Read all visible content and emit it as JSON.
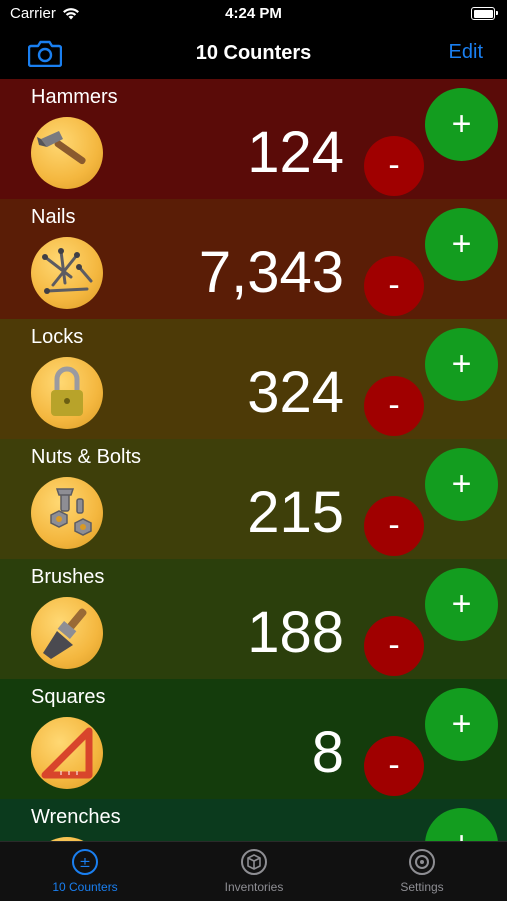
{
  "status_bar": {
    "carrier": "Carrier",
    "time": "4:24 PM"
  },
  "nav": {
    "title": "10 Counters",
    "edit_label": "Edit"
  },
  "counters": [
    {
      "name": "Hammers",
      "count": "124",
      "icon": "hammer-icon",
      "bg": "#5a0b08"
    },
    {
      "name": "Nails",
      "count": "7,343",
      "icon": "nails-icon",
      "bg": "#5a1d06"
    },
    {
      "name": "Locks",
      "count": "324",
      "icon": "lock-icon",
      "bg": "#4d3a07"
    },
    {
      "name": "Nuts & Bolts",
      "count": "215",
      "icon": "nuts-bolts-icon",
      "bg": "#3e3f0a"
    },
    {
      "name": "Brushes",
      "count": "188",
      "icon": "brush-icon",
      "bg": "#2b3f0c"
    },
    {
      "name": "Squares",
      "count": "8",
      "icon": "square-ruler-icon",
      "bg": "#143c0c"
    },
    {
      "name": "Wrenches",
      "count": "",
      "icon": "wrench-icon",
      "bg": "#0b3a1d"
    }
  ],
  "buttons": {
    "minus": "-",
    "plus": "+"
  },
  "tabs": [
    {
      "label": "10 Counters",
      "icon": "counter-icon",
      "active": true
    },
    {
      "label": "Inventories",
      "icon": "box-icon",
      "active": false
    },
    {
      "label": "Settings",
      "icon": "settings-icon",
      "active": false
    }
  ],
  "colors": {
    "accent": "#1a7ff0",
    "plus": "#139d1f",
    "minus": "#a00000"
  }
}
